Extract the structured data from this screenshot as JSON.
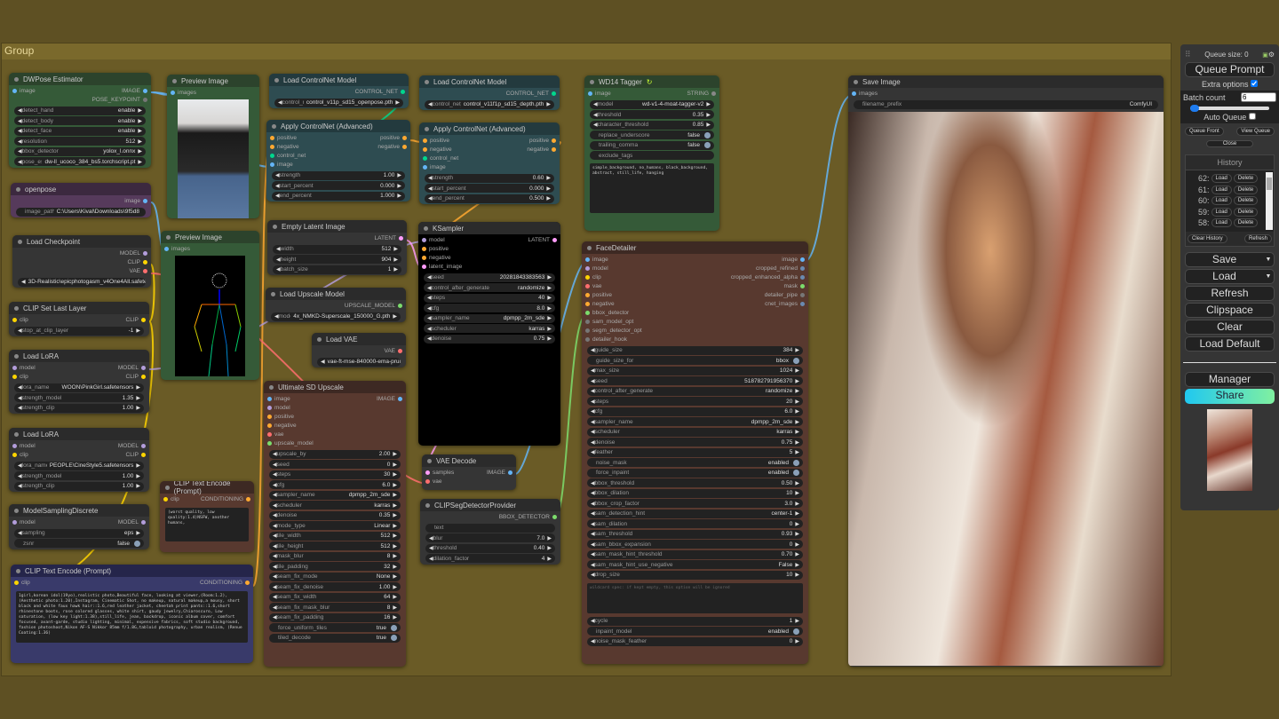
{
  "group": {
    "title": "Group"
  },
  "slot_colors": {
    "IMAGE": "#64b5f6",
    "MODEL": "#b39ddb",
    "CLIP": "#ffd500",
    "VAE": "#ff6e6e",
    "CONDITIONING": "#ffa931",
    "LATENT": "#ff9cf9",
    "CONTROL_NET": "#00d78d",
    "UPSCALE_MODEL": "#7cdc6c",
    "BBOX_DETECTOR": "#7cdc6c",
    "MASK": "#7cdc6c",
    "STRING": "#888",
    "OPT": "#777",
    "MULTI": "#6a8ab0"
  },
  "node_colors": {
    "green": [
      "#2c432c",
      "#355a38"
    ],
    "purple": [
      "#3c293f",
      "#563a5b"
    ],
    "grey": [
      "#2b2b2b",
      "#353535"
    ],
    "teal": [
      "#233a3e",
      "#2e4c51"
    ],
    "brown": [
      "#3d2923",
      "#58392f"
    ],
    "navy": [
      "#25254a",
      "#393a6a"
    ],
    "black": [
      "#2b2b2b",
      "#000000"
    ]
  },
  "nodes": [
    {
      "title": "DWPose Estimator",
      "inputs": [
        [
          "image",
          "IMAGE"
        ]
      ],
      "outputs": [
        [
          "IMAGE",
          "IMAGE"
        ],
        [
          "POSE_KEYPOINT",
          "OPT"
        ]
      ],
      "widgets": [
        [
          "detect_hand",
          "enable"
        ],
        [
          "detect_body",
          "enable"
        ],
        [
          "detect_face",
          "enable"
        ],
        [
          "resolution",
          "512"
        ],
        [
          "bbox_detector",
          "yolox_l.onnx"
        ],
        [
          "pose_estimator",
          "dw-ll_ucoco_384_bs5.torchscript.pt"
        ]
      ]
    },
    {
      "title": "openpose",
      "inputs": [],
      "outputs": [
        [
          "image",
          "IMAGE"
        ]
      ],
      "widgets": [
        [
          "image_path",
          "C:\\Users\\Kival\\Downloads\\9f5d8",
          "text"
        ]
      ]
    },
    {
      "title": "Load Checkpoint",
      "inputs": [],
      "outputs": [
        [
          "MODEL",
          "MODEL"
        ],
        [
          "CLIP",
          "CLIP"
        ],
        [
          "VAE",
          "VAE"
        ]
      ],
      "widgets": [
        [
          "",
          "3D-Realistic\\epicphotogasm_v4One4All.safetensors"
        ]
      ]
    },
    {
      "title": "CLIP Set Last Layer",
      "inputs": [
        [
          "clip",
          "CLIP"
        ]
      ],
      "outputs": [
        [
          "CLIP",
          "CLIP"
        ]
      ],
      "widgets": [
        [
          "stop_at_clip_layer",
          "-1"
        ]
      ]
    },
    {
      "title": "Load LoRA",
      "inputs": [
        [
          "model",
          "MODEL"
        ],
        [
          "clip",
          "CLIP"
        ]
      ],
      "outputs": [
        [
          "MODEL",
          "MODEL"
        ],
        [
          "CLIP",
          "CLIP"
        ]
      ],
      "widgets": [
        [
          "lora_name",
          "WOON\\PinkGirl.safetensors"
        ],
        [
          "strength_model",
          "1.35"
        ],
        [
          "strength_clip",
          "1.00"
        ]
      ]
    },
    {
      "title": "Load LoRA",
      "inputs": [
        [
          "model",
          "MODEL"
        ],
        [
          "clip",
          "CLIP"
        ]
      ],
      "outputs": [
        [
          "MODEL",
          "MODEL"
        ],
        [
          "CLIP",
          "CLIP"
        ]
      ],
      "widgets": [
        [
          "lora_name",
          "PEOPLE\\CineStyle5.safetensors"
        ],
        [
          "strength_model",
          "1.00"
        ],
        [
          "strength_clip",
          "1.00"
        ]
      ]
    },
    {
      "title": "ModelSamplingDiscrete",
      "inputs": [
        [
          "model",
          "MODEL"
        ]
      ],
      "outputs": [
        [
          "MODEL",
          "MODEL"
        ]
      ],
      "widgets": [
        [
          "sampling",
          "eps"
        ],
        [
          "zsnr",
          "false",
          "toggle"
        ]
      ]
    },
    {
      "title": "CLIP Text Encode (Prompt)",
      "inputs": [
        [
          "clip",
          "CLIP"
        ]
      ],
      "outputs": [
        [
          "CONDITIONING",
          "CONDITIONING"
        ]
      ],
      "widgets": [],
      "text": "1girl,korean idol(19yo),realistic photo,Beautiful face, looking at viewer,(Room:1.2),(Aesthetic photo:1.20),Instagram, Cinematic Shot, no makeup, natural makeup,a mousy, short black and white faux hawk hair::1.6,red leather jacket, cheetah print pants::1.6,short rhinestone boots, rose colored glasses, white shirt, gaudy jewelry,Chiaroscuro, Low saturation, (low key light:1.38),still_life, jean, backdrop, iconic album cover, comfort focused, avant-garde, studio lighting, minimal, expensive fabrics, soft studio background, fashion photoshoot,Nikon AF-S Nikkor 85mm f/1.8G,tabloid photography, urban realism, (Renue Coating:1.36)"
    },
    {
      "title": "CLIP Text Encode (Prompt)",
      "inputs": [
        [
          "clip",
          "CLIP"
        ]
      ],
      "outputs": [
        [
          "CONDITIONING",
          "CONDITIONING"
        ]
      ],
      "widgets": [],
      "text": "(worst quality, low quality:1.4)NSFW, another humans,"
    },
    {
      "title": "Preview Image",
      "inputs": [
        [
          "images",
          "IMAGE"
        ]
      ],
      "outputs": [],
      "widgets": [],
      "image": "photo"
    },
    {
      "title": "Preview Image",
      "inputs": [
        [
          "images",
          "IMAGE"
        ]
      ],
      "outputs": [],
      "widgets": [],
      "image": "pose"
    },
    {
      "title": "Load ControlNet Model",
      "inputs": [],
      "outputs": [
        [
          "CONTROL_NET",
          "CONTROL_NET"
        ]
      ],
      "widgets": [
        [
          "control_net_name",
          "control_v11p_sd15_openpose.pth"
        ]
      ]
    },
    {
      "title": "Apply ControlNet (Advanced)",
      "inputs": [
        [
          "positive",
          "CONDITIONING"
        ],
        [
          "negative",
          "CONDITIONING"
        ],
        [
          "control_net",
          "CONTROL_NET"
        ],
        [
          "image",
          "IMAGE"
        ]
      ],
      "outputs": [
        [
          "positive",
          "CONDITIONING"
        ],
        [
          "negative",
          "CONDITIONING"
        ]
      ],
      "widgets": [
        [
          "strength",
          "1.00"
        ],
        [
          "start_percent",
          "0.000"
        ],
        [
          "end_percent",
          "1.000"
        ]
      ]
    },
    {
      "title": "Load ControlNet Model",
      "inputs": [],
      "outputs": [
        [
          "CONTROL_NET",
          "CONTROL_NET"
        ]
      ],
      "widgets": [
        [
          "control_net_name",
          "control_v11f1p_sd15_depth.pth"
        ]
      ]
    },
    {
      "title": "Apply ControlNet (Advanced)",
      "inputs": [
        [
          "positive",
          "CONDITIONING"
        ],
        [
          "negative",
          "CONDITIONING"
        ],
        [
          "control_net",
          "CONTROL_NET"
        ],
        [
          "image",
          "IMAGE"
        ]
      ],
      "outputs": [
        [
          "positive",
          "CONDITIONING"
        ],
        [
          "negative",
          "CONDITIONING"
        ]
      ],
      "widgets": [
        [
          "strength",
          "0.60"
        ],
        [
          "start_percent",
          "0.000"
        ],
        [
          "end_percent",
          "0.500"
        ]
      ]
    },
    {
      "title": "Empty Latent Image",
      "inputs": [],
      "outputs": [
        [
          "LATENT",
          "LATENT"
        ]
      ],
      "widgets": [
        [
          "width",
          "512"
        ],
        [
          "height",
          "904"
        ],
        [
          "batch_size",
          "1"
        ]
      ]
    },
    {
      "title": "Load Upscale Model",
      "inputs": [],
      "outputs": [
        [
          "UPSCALE_MODEL",
          "UPSCALE_MODEL"
        ]
      ],
      "widgets": [
        [
          "model_name",
          "4x_NMKD-Superscale_150000_G.pth"
        ]
      ]
    },
    {
      "title": "Load VAE",
      "inputs": [],
      "outputs": [
        [
          "VAE",
          "VAE"
        ]
      ],
      "widgets": [
        [
          "",
          "vae-ft-mse-840000-ema-pruned.ckpt"
        ]
      ]
    },
    {
      "title": "Ultimate SD Upscale",
      "inputs": [
        [
          "image",
          "IMAGE"
        ],
        [
          "model",
          "MODEL"
        ],
        [
          "positive",
          "CONDITIONING"
        ],
        [
          "negative",
          "CONDITIONING"
        ],
        [
          "vae",
          "VAE"
        ],
        [
          "upscale_model",
          "UPSCALE_MODEL"
        ]
      ],
      "outputs": [
        [
          "IMAGE",
          "IMAGE"
        ]
      ],
      "widgets": [
        [
          "upscale_by",
          "2.00"
        ],
        [
          "seed",
          "0"
        ],
        [
          "steps",
          "30"
        ],
        [
          "cfg",
          "6.0"
        ],
        [
          "sampler_name",
          "dpmpp_2m_sde"
        ],
        [
          "scheduler",
          "karras"
        ],
        [
          "denoise",
          "0.35"
        ],
        [
          "mode_type",
          "Linear"
        ],
        [
          "tile_width",
          "512"
        ],
        [
          "tile_height",
          "512"
        ],
        [
          "mask_blur",
          "8"
        ],
        [
          "tile_padding",
          "32"
        ],
        [
          "seam_fix_mode",
          "None"
        ],
        [
          "seam_fix_denoise",
          "1.00"
        ],
        [
          "seam_fix_width",
          "64"
        ],
        [
          "seam_fix_mask_blur",
          "8"
        ],
        [
          "seam_fix_padding",
          "16"
        ],
        [
          "force_uniform_tiles",
          "true",
          "toggle"
        ],
        [
          "tiled_decode",
          "true",
          "toggle"
        ]
      ]
    },
    {
      "title": "KSampler",
      "inputs": [
        [
          "model",
          "MODEL"
        ],
        [
          "positive",
          "CONDITIONING"
        ],
        [
          "negative",
          "CONDITIONING"
        ],
        [
          "latent_image",
          "LATENT"
        ]
      ],
      "outputs": [
        [
          "LATENT",
          "LATENT"
        ]
      ],
      "widgets": [
        [
          "seed",
          "202818433835​63"
        ],
        [
          "control_after_generate",
          "randomize"
        ],
        [
          "steps",
          "40"
        ],
        [
          "cfg",
          "8.0"
        ],
        [
          "sampler_name",
          "dpmpp_2m_sde"
        ],
        [
          "scheduler",
          "karras"
        ],
        [
          "denoise",
          "0.75"
        ]
      ]
    },
    {
      "title": "VAE Decode",
      "inputs": [
        [
          "samples",
          "LATENT"
        ],
        [
          "vae",
          "VAE"
        ]
      ],
      "outputs": [
        [
          "IMAGE",
          "IMAGE"
        ]
      ],
      "widgets": []
    },
    {
      "title": "CLIPSegDetectorProvider",
      "inputs": [],
      "outputs": [
        [
          "BBOX_DETECTOR",
          "BBOX_DETECTOR"
        ]
      ],
      "widgets": [
        [
          "text",
          "",
          "text"
        ],
        [
          "blur",
          "7.0"
        ],
        [
          "threshold",
          "0.40"
        ],
        [
          "dilation_factor",
          "4"
        ]
      ]
    },
    {
      "title": "WD14 Tagger",
      "inputs": [
        [
          "image",
          "IMAGE"
        ]
      ],
      "outputs": [
        [
          "STRING",
          "STRING"
        ]
      ],
      "widgets": [
        [
          "model",
          "wd-v1-4-moat-tagger-v2"
        ],
        [
          "threshold",
          "0.35"
        ],
        [
          "character_threshold",
          "0.85"
        ],
        [
          "replace_underscore",
          "false",
          "toggle"
        ],
        [
          "trailing_comma",
          "false",
          "toggle"
        ],
        [
          "exclude_tags",
          "",
          "text"
        ]
      ],
      "text": "simple_background, no_humans, black_background, abstract, still_life, hanging"
    },
    {
      "title": "FaceDetailer",
      "inputs": [
        [
          "image",
          "IMAGE"
        ],
        [
          "model",
          "MODEL"
        ],
        [
          "clip",
          "CLIP"
        ],
        [
          "vae",
          "VAE"
        ],
        [
          "positive",
          "CONDITIONING"
        ],
        [
          "negative",
          "CONDITIONING"
        ],
        [
          "bbox_detector",
          "BBOX_DETECTOR"
        ],
        [
          "sam_model_opt",
          "OPT"
        ],
        [
          "segm_detector_opt",
          "OPT"
        ],
        [
          "detailer_hook",
          "OPT"
        ]
      ],
      "outputs": [
        [
          "image",
          "IMAGE"
        ],
        [
          "cropped_refined",
          "MULTI"
        ],
        [
          "cropped_enhanced_alpha",
          "MULTI"
        ],
        [
          "mask",
          "MASK"
        ],
        [
          "detailer_pipe",
          "OPT"
        ],
        [
          "cnet_images",
          "MULTI"
        ]
      ],
      "widgets": [
        [
          "guide_size",
          "384"
        ],
        [
          "guide_size_for",
          "bbox",
          "toggle"
        ],
        [
          "max_size",
          "1024"
        ],
        [
          "seed",
          "518782791956370"
        ],
        [
          "control_after_generate",
          "randomize"
        ],
        [
          "steps",
          "20"
        ],
        [
          "cfg",
          "6.0"
        ],
        [
          "sampler_name",
          "dpmpp_2m_sde"
        ],
        [
          "scheduler",
          "karras"
        ],
        [
          "denoise",
          "0.75"
        ],
        [
          "feather",
          "5"
        ],
        [
          "noise_mask",
          "enabled",
          "toggle"
        ],
        [
          "force_inpaint",
          "enabled",
          "toggle"
        ],
        [
          "bbox_threshold",
          "0.50"
        ],
        [
          "bbox_dilation",
          "10"
        ],
        [
          "bbox_crop_factor",
          "3.0"
        ],
        [
          "sam_detection_hint",
          "center-1"
        ],
        [
          "sam_dilation",
          "0"
        ],
        [
          "sam_threshold",
          "0.93"
        ],
        [
          "sam_bbox_expansion",
          "0"
        ],
        [
          "sam_mask_hint_threshold",
          "0.70"
        ],
        [
          "sam_mask_hint_use_negative",
          "False"
        ],
        [
          "drop_size",
          "10"
        ]
      ],
      "text": "wildcard spec: if kept empty, this option will be ignored",
      "widgets2": [
        [
          "cycle",
          "1"
        ],
        [
          "inpaint_model",
          "enabled",
          "toggle"
        ],
        [
          "noise_mask_feather",
          "0"
        ]
      ]
    },
    {
      "title": "Save Image",
      "inputs": [
        [
          "images",
          "IMAGE"
        ]
      ],
      "outputs": [],
      "widgets": [
        [
          "filename_prefix",
          "ComfyUI",
          "text"
        ]
      ],
      "image": "result"
    }
  ],
  "menu": {
    "queue_size": "Queue size: 0",
    "queue_prompt": "Queue Prompt",
    "extra_options": "Extra options",
    "extra_checked": true,
    "batch_count_label": "Batch count",
    "batch_count": "6",
    "auto_queue": "Auto Queue",
    "auto_checked": false,
    "queue_front": "Queue Front",
    "view_queue": "View Queue",
    "close": "Close",
    "history_title": "History",
    "history": [
      {
        "id": "62:"
      },
      {
        "id": "61:"
      },
      {
        "id": "60:"
      },
      {
        "id": "59:"
      },
      {
        "id": "58:"
      }
    ],
    "load": "Load",
    "delete": "Delete",
    "clear_history": "Clear History",
    "refresh_small": "Refresh",
    "save": "Save",
    "load_btn": "Load",
    "refresh": "Refresh",
    "clipspace": "Clipspace",
    "clear": "Clear",
    "load_default": "Load Default",
    "manager": "Manager",
    "share": "Share",
    "share_gradient": [
      "#20c8f0",
      "#80f0a0"
    ]
  }
}
